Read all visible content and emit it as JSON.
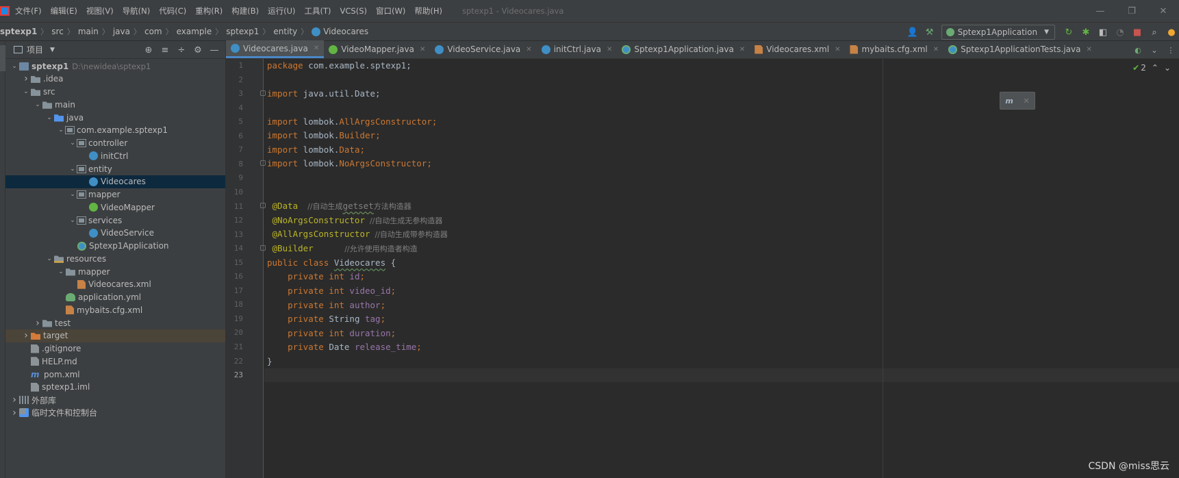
{
  "menubar": {
    "items": [
      "文件(F)",
      "编辑(E)",
      "视图(V)",
      "导航(N)",
      "代码(C)",
      "重构(R)",
      "构建(B)",
      "运行(U)",
      "工具(T)",
      "VCS(S)",
      "窗口(W)",
      "帮助(H)"
    ],
    "window_title": "sptexp1 - Videocares.java",
    "minimize": "—",
    "maximize": "❐",
    "close": "✕"
  },
  "breadcrumb": [
    "sptexp1",
    "src",
    "main",
    "java",
    "com",
    "example",
    "sptexp1",
    "entity",
    "Videocares"
  ],
  "toolbar": {
    "run_config": "Sptexp1Application",
    "icons": [
      "user-icon",
      "build-hammer-icon",
      "rerun-icon",
      "debug-icon",
      "coverage-icon",
      "profile-icon",
      "stop-icon",
      "search-icon",
      "update-icon"
    ]
  },
  "project_panel": {
    "title": "项目",
    "tree": [
      {
        "label": "sptexp1",
        "path": "D:\\newidea\\sptexp1",
        "depth": 0,
        "expanded": true,
        "icon": "module",
        "bold": true
      },
      {
        "label": ".idea",
        "depth": 1,
        "expanded": false,
        "icon": "folder"
      },
      {
        "label": "src",
        "depth": 1,
        "expanded": true,
        "icon": "folder"
      },
      {
        "label": "main",
        "depth": 2,
        "expanded": true,
        "icon": "folder"
      },
      {
        "label": "java",
        "depth": 3,
        "expanded": true,
        "icon": "folder-blue"
      },
      {
        "label": "com.example.sptexp1",
        "depth": 4,
        "expanded": true,
        "icon": "package"
      },
      {
        "label": "controller",
        "depth": 5,
        "expanded": true,
        "icon": "package"
      },
      {
        "label": "initCtrl",
        "depth": 6,
        "icon": "class"
      },
      {
        "label": "entity",
        "depth": 5,
        "expanded": true,
        "icon": "package"
      },
      {
        "label": "Videocares",
        "depth": 6,
        "icon": "class",
        "selected": true
      },
      {
        "label": "mapper",
        "depth": 5,
        "expanded": true,
        "icon": "package"
      },
      {
        "label": "VideoMapper",
        "depth": 6,
        "icon": "interface"
      },
      {
        "label": "services",
        "depth": 5,
        "expanded": true,
        "icon": "package"
      },
      {
        "label": "VideoService",
        "depth": 6,
        "icon": "class"
      },
      {
        "label": "Sptexp1Application",
        "depth": 5,
        "icon": "spring"
      },
      {
        "label": "resources",
        "depth": 3,
        "expanded": true,
        "icon": "folder-res"
      },
      {
        "label": "mapper",
        "depth": 4,
        "expanded": true,
        "icon": "folder"
      },
      {
        "label": "Videocares.xml",
        "depth": 5,
        "icon": "xml"
      },
      {
        "label": "application.yml",
        "depth": 4,
        "icon": "yml"
      },
      {
        "label": "mybaits.cfg.xml",
        "depth": 4,
        "icon": "xml"
      },
      {
        "label": "test",
        "depth": 2,
        "expanded": false,
        "icon": "folder"
      },
      {
        "label": "target",
        "depth": 1,
        "expanded": false,
        "icon": "folder-orange",
        "excluded": true
      },
      {
        "label": ".gitignore",
        "depth": 1,
        "icon": "git"
      },
      {
        "label": "HELP.md",
        "depth": 1,
        "icon": "md"
      },
      {
        "label": "pom.xml",
        "depth": 1,
        "icon": "maven"
      },
      {
        "label": "sptexp1.iml",
        "depth": 1,
        "icon": "iml"
      },
      {
        "label": "外部库",
        "depth": 0,
        "expanded": false,
        "icon": "libs"
      },
      {
        "label": "临时文件和控制台",
        "depth": 0,
        "expanded": false,
        "icon": "scratch"
      }
    ]
  },
  "tabs": [
    {
      "label": "Videocares.java",
      "icon": "class",
      "active": true
    },
    {
      "label": "VideoMapper.java",
      "icon": "interface"
    },
    {
      "label": "VideoService.java",
      "icon": "class"
    },
    {
      "label": "initCtrl.java",
      "icon": "class"
    },
    {
      "label": "Sptexp1Application.java",
      "icon": "spring"
    },
    {
      "label": "Videocares.xml",
      "icon": "xml"
    },
    {
      "label": "mybaits.cfg.xml",
      "icon": "xml"
    },
    {
      "label": "Sptexp1ApplicationTests.java",
      "icon": "spring"
    }
  ],
  "inspection": {
    "count": "2"
  },
  "code": {
    "line_numbers": [
      "1",
      "2",
      "3",
      "4",
      "5",
      "6",
      "7",
      "8",
      "9",
      "10",
      "11",
      "12",
      "13",
      "14",
      "15",
      "16",
      "17",
      "18",
      "19",
      "20",
      "21",
      "22",
      "23"
    ],
    "l1_kw": "package",
    "l1_rest": " com.example.sptexp1;",
    "l3_kw": "import",
    "l3_rest": " java.util.Date;",
    "l5_kw": "import",
    "l5_pkg": " lombok.",
    "l5_cls": "AllArgsConstructor",
    "l5_end": ";",
    "l6_kw": "import",
    "l6_pkg": " lombok.",
    "l6_cls": "Builder",
    "l6_end": ";",
    "l7_kw": "import",
    "l7_pkg": " lombok.",
    "l7_cls": "Data",
    "l7_end": ";",
    "l8_kw": "import",
    "l8_pkg": " lombok.",
    "l8_cls": "NoArgsConstructor",
    "l8_end": ";",
    "l11_ann": " @Data",
    "l11_cmt_a": "    //自动生成",
    "l11_cmt_b": "getset",
    "l11_cmt_c": "方法构造器",
    "l12_ann": " @NoArgsConstructor",
    "l12_cmt": "  //自动生成无参构造器",
    "l13_ann": " @AllArgsConstructor",
    "l13_cmt": "  //自动生成带参构造器",
    "l14_ann": " @Builder",
    "l14_cmt": "             //允许使用构造者构造",
    "l15_kw": "public class",
    "l15_sp": " ",
    "l15_cls": "Videocares",
    "l15_end": " {",
    "f1_kw": "    private int",
    "f1_name": " id",
    "f1_end": ";",
    "f2_kw": "    private int",
    "f2_name": " video_id",
    "f2_end": ";",
    "f3_kw": "    private int",
    "f3_name": " author",
    "f3_end": ";",
    "f4_kw": "    private",
    "f4_type": " String",
    "f4_name": " tag",
    "f4_end": ";",
    "f5_kw": "    private int",
    "f5_name": " duration",
    "f5_end": ";",
    "f6_kw": "    private",
    "f6_type": " Date",
    "f6_name": " release_time",
    "f6_end": ";",
    "l22": "}"
  },
  "watermark": "CSDN @miss思云"
}
